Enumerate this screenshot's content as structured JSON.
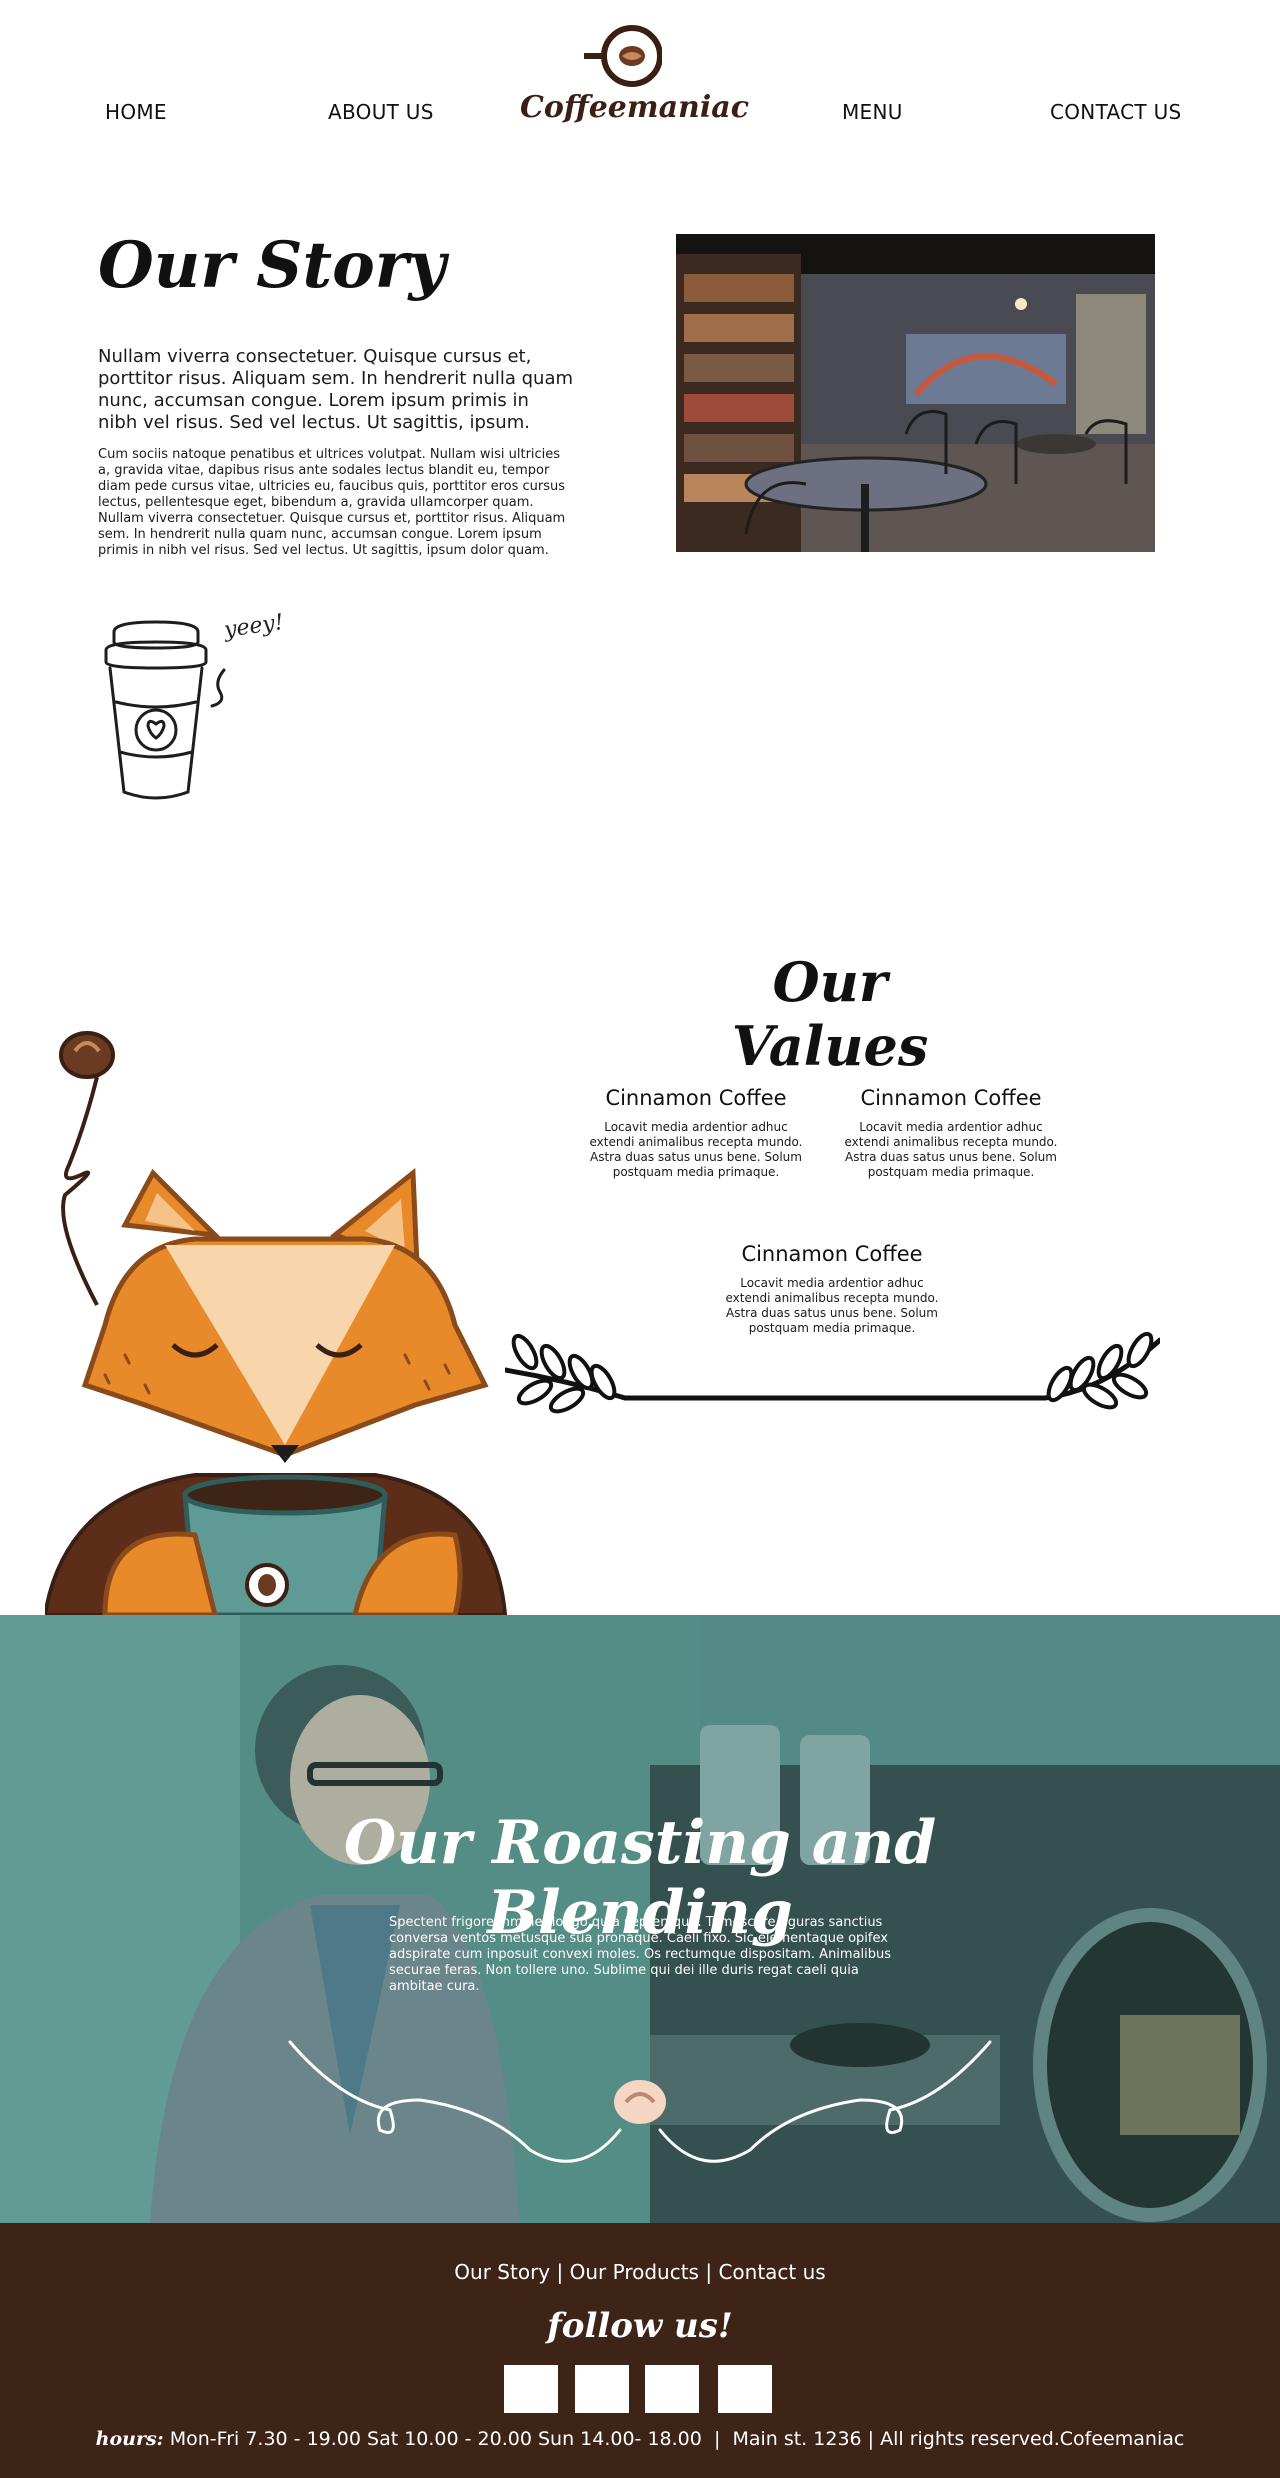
{
  "header": {
    "logo_text": "Coffeemaniac",
    "nav": [
      {
        "label": "HOME"
      },
      {
        "label": "ABOUT US"
      },
      {
        "label": "MENU"
      },
      {
        "label": "CONTACT US"
      }
    ]
  },
  "story": {
    "title": "Our Story",
    "lead": "Nullam viverra consectetuer. Quisque cursus et, porttitor risus. Aliquam sem. In hendrerit nulla quam nunc, accumsan congue. Lorem ipsum primis in nibh vel risus. Sed vel lectus. Ut sagittis, ipsum.",
    "body": "Cum sociis natoque penatibus et ultrices volutpat. Nullam wisi ultricies a, gravida vitae, dapibus risus ante sodales lectus blandit eu, tempor diam pede cursus vitae, ultricies eu, faucibus quis, porttitor eros cursus lectus, pellentesque eget, bibendum a, gravida ullamcorper quam. Nullam viverra consectetuer. Quisque cursus et, porttitor risus. Aliquam sem. In hendrerit nulla quam nunc, accumsan congue. Lorem ipsum primis in nibh vel risus. Sed vel lectus. Ut sagittis, ipsum dolor quam.",
    "doodle_caption": "yeey!"
  },
  "values": {
    "title": "Our Values",
    "items": [
      {
        "title": "Cinnamon Coffee",
        "text": "Locavit media ardentior adhuc extendi animalibus recepta mundo. Astra duas satus unus bene. Solum postquam media primaque."
      },
      {
        "title": "Cinnamon Coffee",
        "text": "Locavit media ardentior adhuc extendi animalibus recepta mundo. Astra duas satus unus bene. Solum postquam media primaque."
      },
      {
        "title": "Cinnamon Coffee",
        "text": "Locavit media ardentior adhuc extendi animalibus recepta mundo. Astra duas satus unus bene. Solum postquam media primaque."
      }
    ]
  },
  "roasting": {
    "title": "Our Roasting and Blending",
    "body": "Spectent frigore inminet longo quia septemque. Tumescere figuras sanctius conversa ventos metusque sua pronaque. Caeli fixo. Sic elementaque opifex adspirate cum inposuit convexi moles. Os rectumque dispositam. Animalibus securae feras. Non tollere uno. Sublime qui dei ille duris regat caeli quia ambitae cura."
  },
  "footer": {
    "links": [
      "Our Story",
      "Our Products",
      "Contact us"
    ],
    "separator": "|",
    "follow": "follow us!",
    "hours_label": "hours:",
    "hours_text": "Mon-Fri 7.30 - 19.00 Sat  10.00 - 20.00 Sun  14.00- 18.00",
    "address": "Main st. 1236 | All rights reserved.Cofeemaniac"
  },
  "colors": {
    "brand_brown": "#3e2317",
    "fox_orange": "#e8892a",
    "teal_overlay": "#5f9a95"
  }
}
